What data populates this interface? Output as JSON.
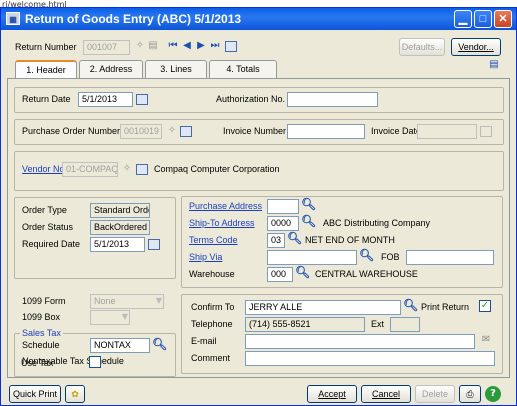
{
  "address_bar": "ri/welcome.html",
  "window": {
    "title": "Return of Goods Entry (ABC) 5/1/2013",
    "controls": [
      "minimize",
      "maximize",
      "close"
    ]
  },
  "header": {
    "return_number_label": "Return Number",
    "return_number_value": "001007",
    "defaults_label": "Defaults...",
    "vendor_label": "Vendor..."
  },
  "tabs": [
    {
      "label": "1. Header",
      "active": true
    },
    {
      "label": "2. Address",
      "active": false
    },
    {
      "label": "3. Lines",
      "active": false
    },
    {
      "label": "4. Totals",
      "active": false
    }
  ],
  "form": {
    "return_date_label": "Return Date",
    "return_date_value": "5/1/2013",
    "authorization_label": "Authorization No.",
    "authorization_value": "",
    "po_number_label": "Purchase Order Number",
    "po_number_value": "0010019",
    "invoice_number_label": "Invoice Number",
    "invoice_number_value": "",
    "invoice_date_label": "Invoice Date",
    "invoice_date_value": "",
    "vendor_no_label": "Vendor No.",
    "vendor_no_value": "01-COMPAQ",
    "vendor_name": "Compaq Computer Corporation"
  },
  "order": {
    "order_type_label": "Order Type",
    "order_type_value": "Standard Order",
    "order_status_label": "Order Status",
    "order_status_value": "BackOrdered",
    "required_date_label": "Required Date",
    "required_date_value": "5/1/2013"
  },
  "form1099": {
    "form_label": "1099 Form",
    "form_value": "None",
    "box_label": "1099 Box",
    "box_value": ""
  },
  "sales_tax": {
    "group_label": "Sales Tax",
    "schedule_label": "Schedule",
    "schedule_value": "NONTAX",
    "schedule_desc": "Nontaxable Tax Schedule",
    "use_tax_label": "Use Tax",
    "use_tax_checked": false
  },
  "addresses": {
    "purchase_address_label": "Purchase Address",
    "purchase_address_value": "",
    "ship_to_label": "Ship-To Address",
    "ship_to_value": "0000",
    "ship_to_name": "ABC Distributing Company",
    "terms_label": "Terms Code",
    "terms_value": "03",
    "terms_desc": "NET END OF MONTH",
    "ship_via_label": "Ship Via",
    "ship_via_value": "",
    "fob_label": "FOB",
    "fob_value": "",
    "warehouse_label": "Warehouse",
    "warehouse_value": "000",
    "warehouse_name": "CENTRAL WAREHOUSE"
  },
  "confirm": {
    "confirm_to_label": "Confirm To",
    "confirm_to_value": "JERRY ALLE",
    "print_return_label": "Print Return",
    "print_return_checked": true,
    "telephone_label": "Telephone",
    "telephone_value": "(714) 555-8521",
    "ext_label": "Ext",
    "ext_value": "",
    "email_label": "E-mail",
    "email_value": "",
    "comment_label": "Comment",
    "comment_value": ""
  },
  "footer": {
    "quick_print_label": "Quick Print",
    "accept_label": "Accept",
    "cancel_label": "Cancel",
    "delete_label": "Delete"
  }
}
